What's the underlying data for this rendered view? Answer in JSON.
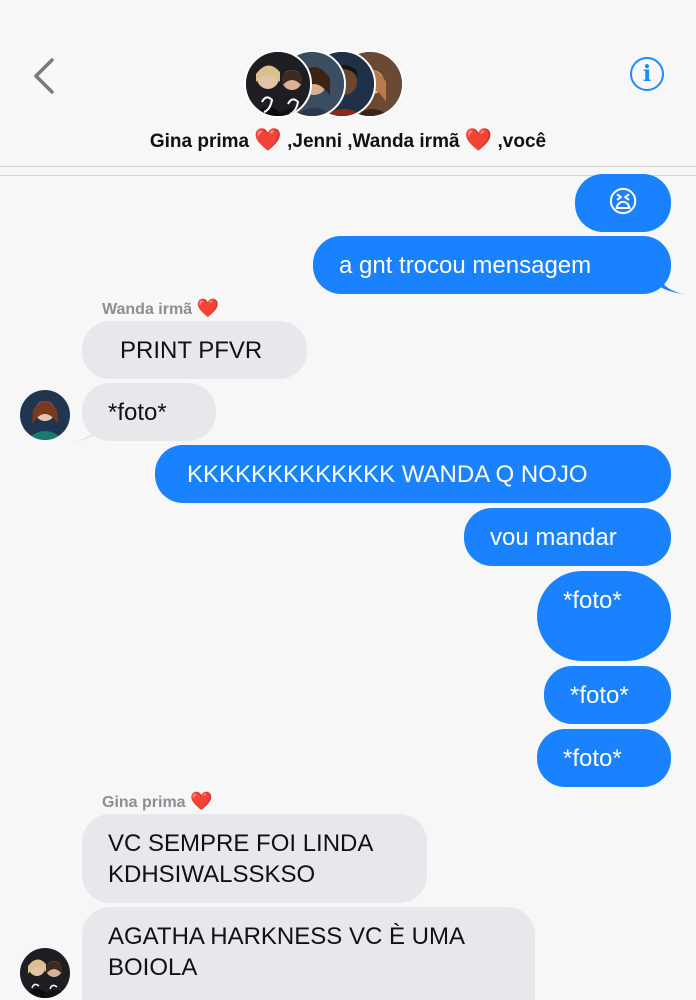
{
  "header": {
    "group_name_parts": [
      "Gina prima",
      ",Jenni ,Wanda irmã",
      ",você"
    ],
    "heart_glyph": "❤️",
    "back_icon": "chevron-left-icon",
    "info_icon": "info-circle-icon",
    "info_glyph": "i"
  },
  "messages": [
    {
      "dir": "out",
      "text": "😫"
    },
    {
      "dir": "out",
      "text": "a gnt trocou mensagem"
    },
    {
      "dir": "in",
      "sender": "Wanda irmã",
      "text": "PRINT PFVR"
    },
    {
      "dir": "in",
      "text": "*foto*"
    },
    {
      "dir": "out",
      "text": "KKKKKKKKKKKKK WANDA Q NOJO"
    },
    {
      "dir": "out",
      "text": "vou mandar"
    },
    {
      "dir": "out",
      "text": "*foto*"
    },
    {
      "dir": "out",
      "text": "*foto*"
    },
    {
      "dir": "out",
      "text": "*foto*"
    },
    {
      "dir": "in",
      "sender": "Gina prima",
      "text": "VC SEMPRE FOI LINDA KDHSIWALSSKSO"
    },
    {
      "dir": "in",
      "text": "AGATHA HARKNESS VC È UMA BOIOLA"
    }
  ],
  "colors": {
    "outgoing": "#1a81ff",
    "incoming": "#e8e7ec",
    "accent": "#1a8cff",
    "heart": "#e0192d"
  }
}
